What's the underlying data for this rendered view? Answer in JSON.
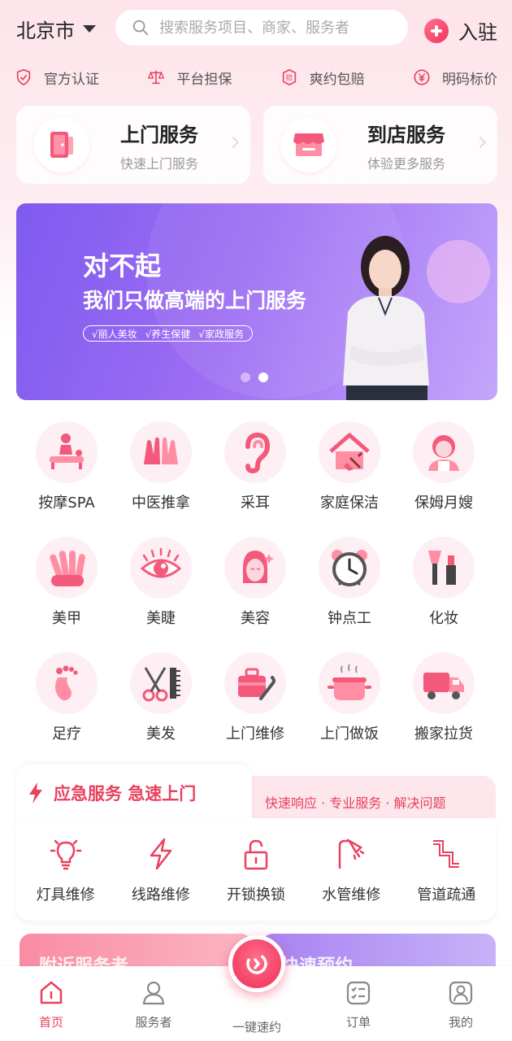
{
  "header": {
    "city": "北京市",
    "search_placeholder": "搜索服务项目、商家、服务者",
    "join_label": "入驻"
  },
  "features": [
    {
      "icon": "shield-check-icon",
      "label": "官方认证"
    },
    {
      "icon": "scale-icon",
      "label": "平台担保"
    },
    {
      "icon": "compensation-icon",
      "label": "爽约包赔"
    },
    {
      "icon": "yen-icon",
      "label": "明码标价"
    }
  ],
  "service_cards": [
    {
      "title": "上门服务",
      "subtitle": "快速上门服务",
      "icon": "door-icon"
    },
    {
      "title": "到店服务",
      "subtitle": "体验更多服务",
      "icon": "store-icon"
    }
  ],
  "banner": {
    "title": "对不起",
    "subtitle": "我们只做高端的上门服务",
    "tags": [
      "√丽人美妆",
      "√养生保健",
      "√家政服务"
    ],
    "slide_count": 2,
    "active_slide": 2
  },
  "categories": [
    {
      "label": "按摩SPA",
      "icon": "massage-icon"
    },
    {
      "label": "中医推拿",
      "icon": "hands-icon"
    },
    {
      "label": "采耳",
      "icon": "ear-icon"
    },
    {
      "label": "家庭保洁",
      "icon": "house-clean-icon"
    },
    {
      "label": "保姆月嫂",
      "icon": "nanny-icon"
    },
    {
      "label": "美甲",
      "icon": "nail-icon"
    },
    {
      "label": "美睫",
      "icon": "eye-icon"
    },
    {
      "label": "美容",
      "icon": "beauty-face-icon"
    },
    {
      "label": "钟点工",
      "icon": "alarm-clock-icon"
    },
    {
      "label": "化妆",
      "icon": "makeup-icon"
    },
    {
      "label": "足疗",
      "icon": "foot-icon"
    },
    {
      "label": "美发",
      "icon": "scissors-comb-icon"
    },
    {
      "label": "上门维修",
      "icon": "toolbox-icon"
    },
    {
      "label": "上门做饭",
      "icon": "cooking-pot-icon"
    },
    {
      "label": "搬家拉货",
      "icon": "truck-icon"
    }
  ],
  "emergency": {
    "title": "应急服务 急速上门",
    "slogan": "快速响应 · 专业服务 · 解决问题",
    "items": [
      {
        "label": "灯具维修",
        "icon": "lightbulb-icon"
      },
      {
        "label": "线路维修",
        "icon": "lightning-icon"
      },
      {
        "label": "开锁换锁",
        "icon": "unlock-icon"
      },
      {
        "label": "水管维修",
        "icon": "shower-icon"
      },
      {
        "label": "管道疏通",
        "icon": "pipe-icon"
      }
    ]
  },
  "peek_cards": [
    {
      "text": "附近服务者"
    },
    {
      "text": "快速预约"
    }
  ],
  "bottom_nav": [
    {
      "label": "首页",
      "icon": "home-icon",
      "active": true
    },
    {
      "label": "服务者",
      "icon": "person-icon",
      "active": false
    },
    {
      "label": "一键速约",
      "icon": "quick-book-icon",
      "active": false
    },
    {
      "label": "订单",
      "icon": "order-list-icon",
      "active": false
    },
    {
      "label": "我的",
      "icon": "profile-icon",
      "active": false
    }
  ],
  "colors": {
    "accent": "#e8415f",
    "banner_start": "#7e5bef",
    "banner_end": "#c4a6fb",
    "icon_bg": "#fdeff3"
  }
}
